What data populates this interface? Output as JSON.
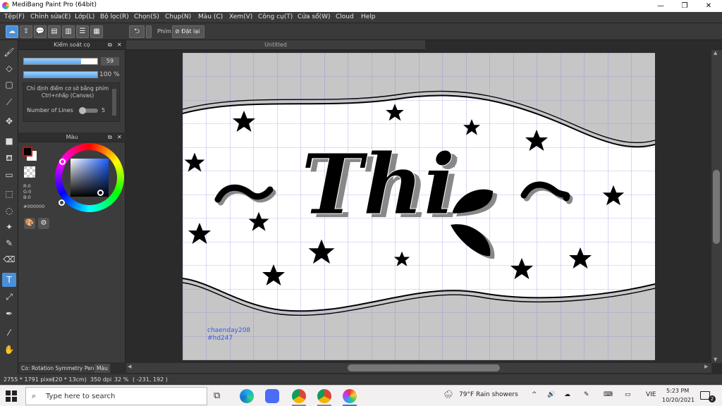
{
  "window": {
    "title": "MediBang Paint Pro (64bit)",
    "min": "—",
    "max": "❐",
    "close": "✕"
  },
  "menu": [
    {
      "label": "Tệp(F)"
    },
    {
      "label": "Chỉnh sửa(E)"
    },
    {
      "label": "Lớp(L)"
    },
    {
      "label": "Bộ lọc(R)"
    },
    {
      "label": "Chọn(S)"
    },
    {
      "label": "Chụp(N)"
    },
    {
      "label": "Màu (C)"
    },
    {
      "label": "Xem(V)"
    },
    {
      "label": "Công cụ(T)"
    },
    {
      "label": "Cửa sổ(W)"
    },
    {
      "label": "Cloud"
    },
    {
      "label": "Help"
    }
  ],
  "toolbar": {
    "phim_label": "Phím",
    "reset_label": "Đặt lại"
  },
  "brush_panel": {
    "title": "Kiểm soát cọ",
    "size_value": "59",
    "size_fraction": 0.78,
    "opacity_value": "100 %",
    "opacity_fraction": 1.0,
    "hint": "Chỉ định điểm cơ sở bằng phím Ctrl+nhấp (Canvas)",
    "lines_label": "Number of Lines",
    "lines_value": "5"
  },
  "color_panel": {
    "title": "Màu",
    "r": "R:0",
    "g": "G:0",
    "b": "B:0",
    "hex": "#000000",
    "fg_color": "#000000",
    "bg_color": "#ffffff"
  },
  "document": {
    "tab": "Untitled"
  },
  "canvas": {
    "main_text": "Thi",
    "signature_line1": "chaenday208",
    "signature_line2": "#hd247"
  },
  "bottom_tabs": {
    "brush": "Co: Rotation Symmetry Pen",
    "color": "Màu"
  },
  "status": {
    "size": "2755 * 1791 pixel",
    "dims": "(20 * 13cm)",
    "dpi": "350 dpi",
    "zoom": "32 %",
    "coords": "( -231, 192 )"
  },
  "taskbar": {
    "search_placeholder": "Type here to search",
    "weather": "79°F  Rain showers",
    "lang": "VIE",
    "time": "5:23 PM",
    "date": "10/20/2021",
    "notif_count": "2"
  }
}
